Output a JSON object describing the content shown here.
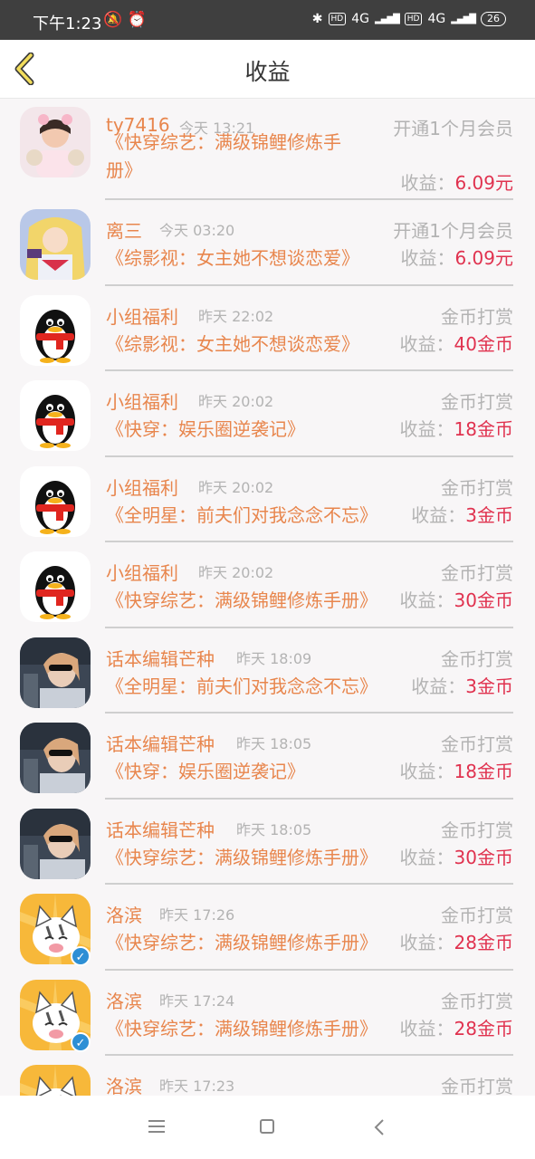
{
  "status_bar": {
    "time": "下午1:23",
    "left_icons": "🔕 ⏰",
    "hd1": "HD",
    "net1": "4G",
    "hd2": "HD",
    "net2": "4G",
    "battery": "26"
  },
  "header": {
    "title": "收益"
  },
  "earnings": [
    {
      "name": "ty7416",
      "time": "今天 13:21",
      "type": "开通1个月会员",
      "book": "《快穿综艺：满级锦鲤修炼手册》",
      "label": "收益：",
      "amount": "6.09元"
    },
    {
      "name": "离三",
      "time": "今天 03:20",
      "type": "开通1个月会员",
      "book": "《综影视：女主她不想谈恋爱》",
      "label": "收益：",
      "amount": "6.09元"
    },
    {
      "name": "小组福利",
      "time": "昨天 22:02",
      "type": "金币打赏",
      "book": "《综影视：女主她不想谈恋爱》",
      "label": "收益：",
      "amount": "40金币"
    },
    {
      "name": "小组福利",
      "time": "昨天 20:02",
      "type": "金币打赏",
      "book": "《快穿：娱乐圈逆袭记》",
      "label": "收益：",
      "amount": "18金币"
    },
    {
      "name": "小组福利",
      "time": "昨天 20:02",
      "type": "金币打赏",
      "book": "《全明星：前夫们对我念念不忘》",
      "label": "收益：",
      "amount": "3金币"
    },
    {
      "name": "小组福利",
      "time": "昨天 20:02",
      "type": "金币打赏",
      "book": "《快穿综艺：满级锦鲤修炼手册》",
      "label": "收益：",
      "amount": "30金币"
    },
    {
      "name": "话本编辑芒种",
      "time": "昨天 18:09",
      "type": "金币打赏",
      "book": "《全明星：前夫们对我念念不忘》",
      "label": "收益：",
      "amount": "3金币"
    },
    {
      "name": "话本编辑芒种",
      "time": "昨天 18:05",
      "type": "金币打赏",
      "book": "《快穿：娱乐圈逆袭记》",
      "label": "收益：",
      "amount": "18金币"
    },
    {
      "name": "话本编辑芒种",
      "time": "昨天 18:05",
      "type": "金币打赏",
      "book": "《快穿综艺：满级锦鲤修炼手册》",
      "label": "收益：",
      "amount": "30金币"
    },
    {
      "name": "洛滨",
      "time": "昨天 17:26",
      "type": "金币打赏",
      "book": "《快穿综艺：满级锦鲤修炼手册》",
      "label": "收益：",
      "amount": "28金币"
    },
    {
      "name": "洛滨",
      "time": "昨天 17:24",
      "type": "金币打赏",
      "book": "《快穿综艺：满级锦鲤修炼手册》",
      "label": "收益：",
      "amount": "28金币"
    },
    {
      "name": "洛滨",
      "time": "昨天 17:23",
      "type": "金币打赏",
      "book": "",
      "label": "",
      "amount": ""
    }
  ],
  "colors": {
    "accent": "#e8864d",
    "amount": "#e0324f",
    "muted": "#b3b3b3"
  }
}
